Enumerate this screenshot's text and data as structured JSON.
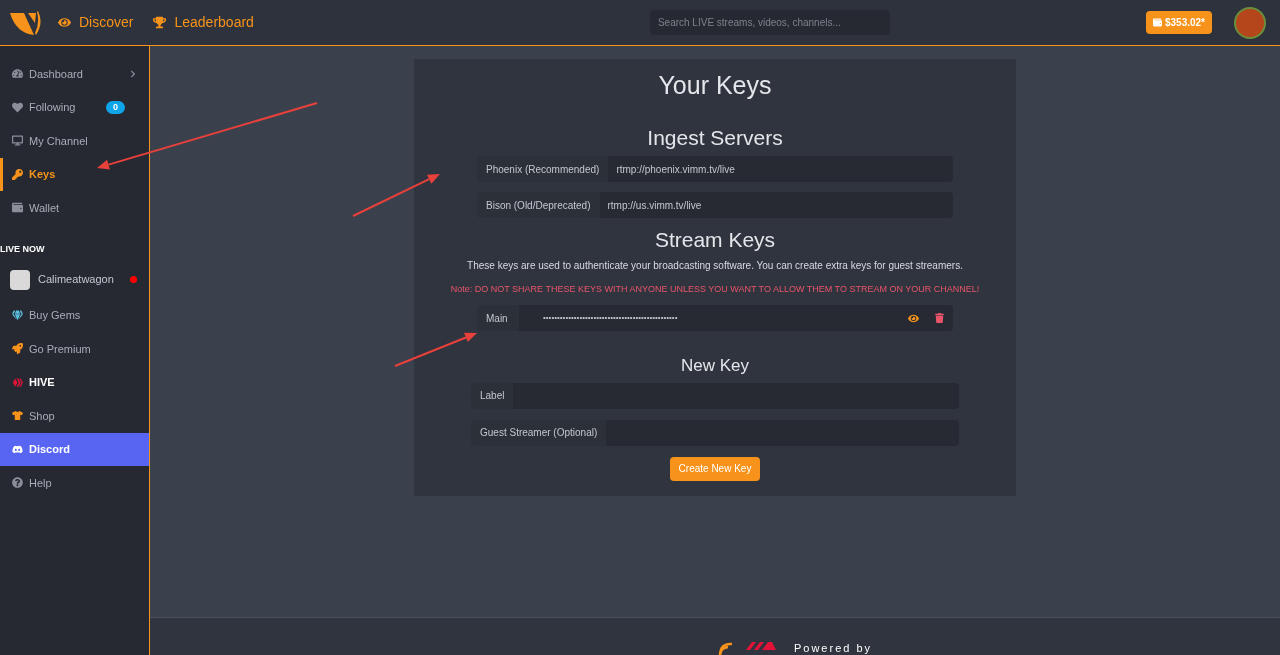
{
  "topbar": {
    "nav": [
      {
        "label": "Discover"
      },
      {
        "label": "Leaderboard"
      }
    ],
    "search": {
      "placeholder": "Search LIVE streams, videos, channels..."
    },
    "balance": "$353.02*"
  },
  "sidebar": {
    "items": [
      {
        "kind": "link",
        "label": "Dashboard",
        "selected": false,
        "expandable": true
      },
      {
        "kind": "link",
        "label": "Following",
        "selected": false,
        "badge": "0"
      },
      {
        "kind": "link",
        "label": "My Channel",
        "selected": false
      },
      {
        "kind": "link",
        "label": "Keys",
        "selected": true
      },
      {
        "kind": "link",
        "label": "Wallet",
        "selected": false
      },
      {
        "kind": "header",
        "label": "LIVE NOW"
      },
      {
        "kind": "channel",
        "label": "Calimeatwagon",
        "live": true
      },
      {
        "kind": "link",
        "label": "Buy Gems",
        "selected": false
      },
      {
        "kind": "link",
        "label": "Go Premium",
        "selected": false
      },
      {
        "kind": "strong",
        "label": "HIVE",
        "selected": false
      },
      {
        "kind": "link",
        "label": "Shop",
        "selected": false
      },
      {
        "kind": "accent",
        "label": "Discord",
        "selected": false
      },
      {
        "kind": "link",
        "label": "Help",
        "selected": false
      }
    ]
  },
  "page": {
    "title": "Your Keys",
    "ingest": {
      "title": "Ingest Servers",
      "servers": [
        {
          "label": "Phoenix (Recommended)",
          "value": "rtmp://phoenix.vimm.tv/live"
        },
        {
          "label": "Bison (Old/Deprecated)",
          "value": "rtmp://us.vimm.tv/live"
        }
      ]
    },
    "stream_keys": {
      "title": "Stream Keys",
      "description": "These keys are used to authenticate your broadcasting software. You can create extra keys for guest streamers.",
      "warning": "Note: DO NOT SHARE THESE KEYS WITH ANYONE UNLESS YOU WANT TO ALLOW THEM TO STREAM ON YOUR CHANNEL!",
      "keys": [
        {
          "label": "Main",
          "value": "••••••••••••••••••••••••••••••••••••••••••••••••"
        }
      ]
    },
    "new_key": {
      "title": "New Key",
      "fields": [
        {
          "label": "Label"
        },
        {
          "label": "Guest Streamer (Optional)"
        }
      ],
      "button": "Create New Key"
    }
  },
  "footer": {
    "text": "Powered by"
  }
}
